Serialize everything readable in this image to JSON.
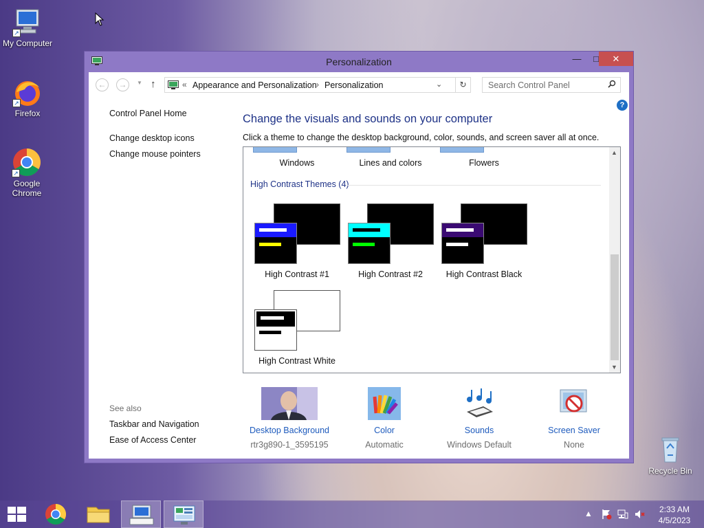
{
  "desktop": {
    "icons": [
      {
        "label": "My Computer"
      },
      {
        "label": "Firefox"
      },
      {
        "label": "Google Chrome"
      },
      {
        "label": "Recycle Bin"
      }
    ]
  },
  "window": {
    "title": "Personalization",
    "address": {
      "chevrons": "«",
      "crumb1": "Appearance and Personalization",
      "separator": "›",
      "crumb2": "Personalization"
    },
    "search_placeholder": "Search Control Panel",
    "sidebar": {
      "home": "Control Panel Home",
      "links": [
        "Change desktop icons",
        "Change mouse pointers"
      ],
      "see_also_title": "See also",
      "see_also": [
        "Taskbar and Navigation",
        "Ease of Access Center"
      ]
    },
    "heading": "Change the visuals and sounds on your computer",
    "subtext": "Click a theme to change the desktop background, color, sounds, and screen saver all at once.",
    "themes": {
      "top_row": [
        "Windows",
        "Lines and colors",
        "Flowers"
      ],
      "group_title": "High Contrast Themes (4)",
      "high_contrast": [
        {
          "name": "High Contrast #1",
          "header": "#1a1aff",
          "bar1": "#ffffff",
          "bar2": "#ffff00"
        },
        {
          "name": "High Contrast #2",
          "header": "#00ffff",
          "bar1": "#000000",
          "bar2": "#00ff00"
        },
        {
          "name": "High Contrast Black",
          "header": "#3a0a72",
          "bar1": "#ffffff",
          "bar2": "#ffffff"
        },
        {
          "name": "High Contrast White",
          "header": "#ffffff",
          "bar1": "#000000",
          "bar2": "#000000"
        }
      ]
    },
    "bottom": [
      {
        "label": "Desktop Background",
        "value": "rtr3g890-1_3595195",
        "icon": "wallpaper-thumbnail"
      },
      {
        "label": "Color",
        "value": "Automatic",
        "icon": "color-palette-icon"
      },
      {
        "label": "Sounds",
        "value": "Windows Default",
        "icon": "music-notes-icon"
      },
      {
        "label": "Screen Saver",
        "value": "None",
        "icon": "screen-saver-icon"
      }
    ]
  },
  "taskbar": {
    "time": "2:33 AM",
    "date": "4/5/2023"
  },
  "colors": {
    "link_blue": "#1e5bbd",
    "heading_blue": "#1e3287",
    "window_frame": "#8e79c6",
    "close_red": "#c75050"
  }
}
